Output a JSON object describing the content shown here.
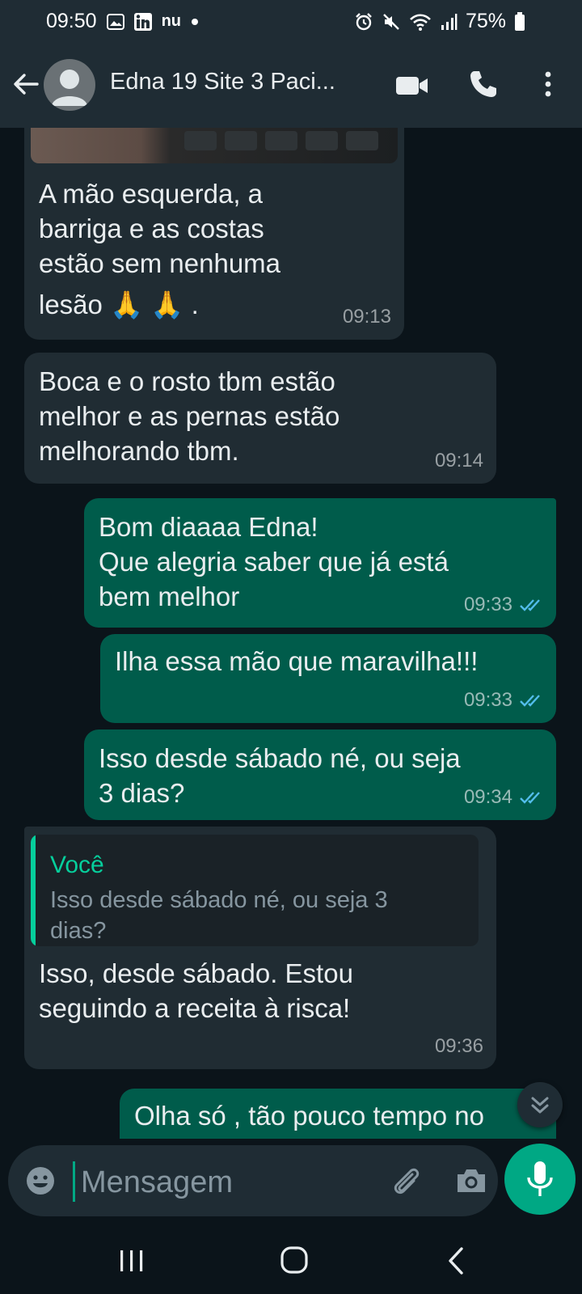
{
  "status_bar": {
    "time": "09:50",
    "carrier_label": "nu",
    "battery": "75%"
  },
  "header": {
    "contact_name": "Edna 19 Site 3 Paci..."
  },
  "messages": [
    {
      "direction": "incoming",
      "text": [
        "A mão esquerda, a",
        "barriga e as costas",
        "estão sem nenhuma",
        "lesão 🙏 🙏 ."
      ],
      "time": "09:13"
    },
    {
      "direction": "incoming",
      "text": [
        "Boca e o rosto tbm estão",
        "melhor e as pernas estão",
        "melhorando tbm."
      ],
      "time": "09:14"
    },
    {
      "direction": "outgoing",
      "text": [
        "Bom diaaaa Edna!",
        "Que alegria saber que já está",
        "bem melhor"
      ],
      "time": "09:33",
      "status": "read"
    },
    {
      "direction": "outgoing",
      "text": [
        "Ilha essa mão que maravilha!!!"
      ],
      "time": "09:33",
      "status": "read"
    },
    {
      "direction": "outgoing",
      "text": [
        "Isso desde sábado né,  ou seja",
        "3 dias?"
      ],
      "time": "09:34",
      "status": "read"
    },
    {
      "direction": "incoming",
      "quote": {
        "author": "Você",
        "text": [
          "Isso desde sábado né,  ou seja 3",
          "dias?"
        ]
      },
      "text": [
        "Isso, desde sábado. Estou",
        "seguindo a receita à risca!"
      ],
      "time": "09:36"
    },
    {
      "direction": "outgoing",
      "text": [
        "Olha só , tão pouco tempo no"
      ]
    }
  ],
  "input": {
    "placeholder": "Mensagem"
  },
  "colors": {
    "background": "#0b141a",
    "bar": "#1f2c34",
    "incoming_bubble": "#202c33",
    "outgoing_bubble": "#005c4b",
    "accent": "#00a884",
    "read_ticks": "#53bdeb"
  },
  "icons": {
    "header": [
      "back-arrow-icon",
      "avatar-icon",
      "video-call-icon",
      "voice-call-icon",
      "more-options-icon"
    ],
    "input": [
      "emoji-icon",
      "attach-icon",
      "camera-icon",
      "mic-icon"
    ],
    "nav": [
      "recents-icon",
      "home-icon",
      "nav-back-icon"
    ]
  }
}
